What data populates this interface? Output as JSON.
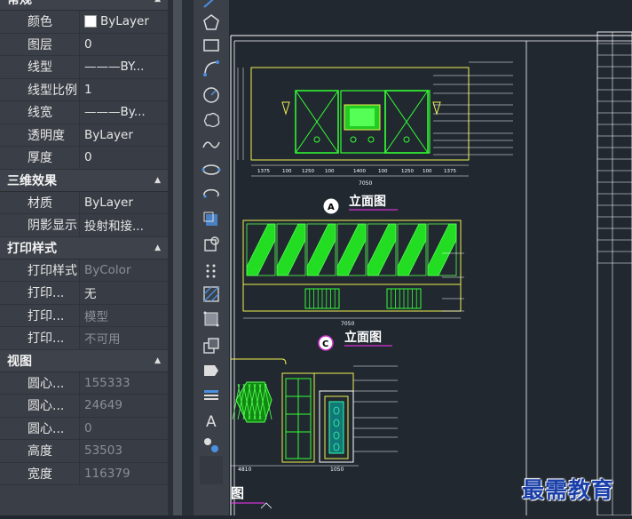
{
  "properties": {
    "sections": [
      {
        "title": "常规",
        "rows": [
          {
            "label": "颜色",
            "value": "ByLayer"
          },
          {
            "label": "图层",
            "value": "0"
          },
          {
            "label": "线型",
            "value": "———BY..."
          },
          {
            "label": "线型比例",
            "value": "1"
          },
          {
            "label": "线宽",
            "value": "———By..."
          },
          {
            "label": "透明度",
            "value": "ByLayer"
          },
          {
            "label": "厚度",
            "value": "0"
          }
        ]
      },
      {
        "title": "三维效果",
        "rows": [
          {
            "label": "材质",
            "value": "ByLayer"
          },
          {
            "label": "阴影显示",
            "value": "投射和接..."
          }
        ]
      },
      {
        "title": "打印样式",
        "rows": [
          {
            "label": "打印样式",
            "value": "ByColor"
          },
          {
            "label": "打印...",
            "value": "无"
          },
          {
            "label": "打印...",
            "value": "模型"
          },
          {
            "label": "打印...",
            "value": "不可用"
          }
        ]
      },
      {
        "title": "视图",
        "rows": [
          {
            "label": "圆心...",
            "value": "155333"
          },
          {
            "label": "圆心...",
            "value": "24649"
          },
          {
            "label": "圆心...",
            "value": "0"
          },
          {
            "label": "高度",
            "value": "53503"
          },
          {
            "label": "宽度",
            "value": "116379"
          }
        ]
      }
    ]
  },
  "drawing": {
    "elevation_a_title": "立面图",
    "elevation_a_tag": "A",
    "elevation_c_title": "立面图",
    "elevation_c_tag": "C",
    "bottom_partial_title": "图",
    "dim_a": [
      "1375",
      "100",
      "1250",
      "100",
      "1400",
      "100",
      "1250",
      "100",
      "1375"
    ],
    "total_a": "7050",
    "total_c": "7050",
    "dim_bottom_left": "4810",
    "dim_bottom_mid": "1050"
  },
  "watermark": "最需教育"
}
